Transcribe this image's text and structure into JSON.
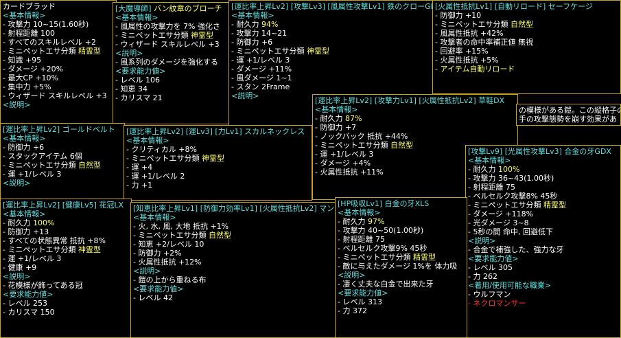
{
  "tooltips": [
    {
      "id": "t1",
      "title": [
        {
          "t": "カードブラッド",
          "c": "wt"
        }
      ],
      "sections": [
        {
          "header": "<基本情報>",
          "lines": [
            [
              {
                "t": "- 攻撃力 10~15(1.60秒)"
              }
            ],
            [
              {
                "t": "- 射程距離 100"
              }
            ],
            [
              {
                "t": "- すべてのスキルレベル +2"
              }
            ],
            [
              {
                "t": "- ミニペットエサ分類 "
              },
              {
                "t": "精霊型",
                "c": "sp"
              }
            ],
            [
              {
                "t": "- 知識 +95"
              }
            ],
            [
              {
                "t": "- ダメージ +20%"
              }
            ],
            [
              {
                "t": "- 最大CP +10%"
              }
            ],
            [
              {
                "t": "- 集中力 +5%"
              }
            ],
            [
              {
                "t": "- ウィザード スキルレベル +3"
              }
            ]
          ]
        },
        {
          "header": "<説明>",
          "lines": []
        }
      ]
    },
    {
      "id": "t2",
      "title": [
        {
          "t": "[大魔導師] ",
          "c": "cy"
        },
        {
          "t": "バン紋章のブローチ",
          "c": "nat"
        }
      ],
      "sections": [
        {
          "header": "<基本情報>",
          "lines": [
            [
              {
                "t": "- 風属性の攻撃力を 7% 強化さ"
              }
            ],
            [
              {
                "t": "- ミニペットエサ分類 "
              },
              {
                "t": "神霊型",
                "c": "sp"
              }
            ],
            [
              {
                "t": "- ウィザード スキルレベル +3"
              }
            ]
          ]
        },
        {
          "header": "<説明>",
          "lines": [
            [
              {
                "t": "- 風系列のダメージを強化する"
              }
            ]
          ]
        },
        {
          "header": "<要求能力値>",
          "lines": [
            [
              {
                "t": "- レベル 106"
              }
            ],
            [
              {
                "t": "- 知恵 34"
              }
            ],
            [
              {
                "t": "- カリスマ 21"
              }
            ]
          ]
        }
      ]
    },
    {
      "id": "t3",
      "title": [
        {
          "t": "[運比率上昇Lv2] [攻撃Lv3] [風属性攻撃Lv1] 鉄のクローGDX",
          "c": "cy"
        }
      ],
      "sections": [
        {
          "header": "<基本情報>",
          "lines": [
            [
              {
                "t": "- 耐久力 "
              },
              {
                "t": "94%",
                "c": "nat"
              }
            ],
            [
              {
                "t": "- 攻撃力 14~21"
              }
            ],
            [
              {
                "t": "- 防御力 +6"
              }
            ],
            [
              {
                "t": "- ミニペットエサ分類 "
              },
              {
                "t": "神霊型",
                "c": "sp"
              }
            ],
            [
              {
                "t": "- 運 +1/レベル 3"
              }
            ],
            [
              {
                "t": "- ダメージ +11%"
              }
            ],
            [
              {
                "t": "- 風ダメージ 1~1"
              }
            ],
            [
              {
                "t": "- スタン 2Frame"
              }
            ]
          ]
        },
        {
          "header": "<説明>",
          "lines": []
        }
      ]
    },
    {
      "id": "t4",
      "title": [
        {
          "t": "[火属性抵抗Lv1] [自動リロード] セーフケージ",
          "c": "cy"
        }
      ],
      "sections": [
        {
          "header": "",
          "lines": [
            [
              {
                "t": "- 防御力 +10"
              }
            ],
            [
              {
                "t": "- ミニペットエサ分類 "
              },
              {
                "t": "自然型",
                "c": "nat"
              }
            ],
            [
              {
                "t": "- 風属性抵抗 +42%"
              }
            ],
            [
              {
                "t": "- 攻撃者の命中率補正値 無視"
              }
            ],
            [
              {
                "t": "- 回避率 +15%"
              }
            ],
            [
              {
                "t": "- 火属性抵抗 +5%"
              }
            ],
            [
              {
                "t": "- アイテム自動リロード",
                "c": "nat"
              }
            ]
          ]
        }
      ]
    },
    {
      "id": "t5",
      "title": [
        {
          "t": "[運比率上昇Lv2] ゴールドベルト",
          "c": "cy"
        }
      ],
      "sections": [
        {
          "header": "<基本情報>",
          "lines": [
            [
              {
                "t": "- 防御力 +6"
              }
            ],
            [
              {
                "t": "- スタックアイテム 6個"
              }
            ],
            [
              {
                "t": "- ミニペットエサ分類 "
              },
              {
                "t": "自然型",
                "c": "nat"
              }
            ],
            [
              {
                "t": "- 運 +1/レベル 3"
              }
            ]
          ]
        },
        {
          "header": "<説明>",
          "lines": []
        }
      ]
    },
    {
      "id": "t6",
      "title": [
        {
          "t": "[運比率上昇Lv2] [運Lv3] [力Lv1] スカルネックレス",
          "c": "cy"
        }
      ],
      "sections": [
        {
          "header": "<基本情報>",
          "lines": [
            [
              {
                "t": "- クリティカル +8%"
              }
            ],
            [
              {
                "t": "- ミニペットエサ分類 "
              },
              {
                "t": "神霊型",
                "c": "sp"
              }
            ],
            [
              {
                "t": "- 運 +4"
              }
            ],
            [
              {
                "t": "- 運 +1/レベル 2"
              }
            ],
            [
              {
                "t": "- 力 +1"
              }
            ]
          ]
        }
      ]
    },
    {
      "id": "t7",
      "title": [
        {
          "t": "[運比率上昇Lv2] [攻撃力Lv1] [火属性抵抗Lv2] 草鞋DX",
          "c": "cy"
        }
      ],
      "sections": [
        {
          "header": "<基本情報>",
          "lines": [
            [
              {
                "t": "- 耐久力 "
              },
              {
                "t": "87%",
                "c": "nat"
              }
            ],
            [
              {
                "t": "- 防御力 +7"
              }
            ],
            [
              {
                "t": "- ノックバック 抵抗 +44%"
              }
            ],
            [
              {
                "t": "- ミニペットエサ分類 "
              },
              {
                "t": "自然型",
                "c": "nat"
              }
            ],
            [
              {
                "t": "- 運 +1/レベル 3"
              }
            ],
            [
              {
                "t": "- ダメージ +4%"
              }
            ],
            [
              {
                "t": "- 火属性抵抗 +11%"
              }
            ]
          ]
        }
      ]
    },
    {
      "id": "t8",
      "title": [
        {
          "t": "の模様がある鎧。この縦格子の",
          "c": "wt"
        }
      ],
      "sections": [
        {
          "header": "",
          "lines": [
            [
              {
                "t": "手の攻撃態勢を崩す効果があ"
              }
            ]
          ]
        }
      ]
    },
    {
      "id": "t9",
      "title": [
        {
          "t": "[攻撃Lv9] [光属性攻撃Lv3] 合金の牙GDX",
          "c": "cy"
        }
      ],
      "sections": [
        {
          "header": "<基本情報>",
          "lines": [
            [
              {
                "t": "- 耐久力 "
              },
              {
                "t": "100%",
                "c": "nat"
              }
            ],
            [
              {
                "t": "- 攻撃力 36~43(1.00秒)"
              }
            ],
            [
              {
                "t": "- 射程距離 75"
              }
            ],
            [
              {
                "t": "- ベルセルク攻撃8% 45秒"
              }
            ],
            [
              {
                "t": "- ミニペットエサ分類 "
              },
              {
                "t": "精霊型",
                "c": "sp"
              }
            ],
            [
              {
                "t": "- ダメージ +118%"
              }
            ],
            [
              {
                "t": "- 光ダメージ 3~8"
              }
            ],
            [
              {
                "t": "- 5秒の間 命中, 回避低下"
              }
            ]
          ]
        },
        {
          "header": "<説明>",
          "lines": [
            [
              {
                "t": "- 合金で補強した、強力な牙"
              }
            ]
          ]
        },
        {
          "header": "<要求能力値>",
          "lines": [
            [
              {
                "t": "- レベル 305"
              }
            ],
            [
              {
                "t": "- 力 262"
              }
            ]
          ]
        },
        {
          "header": "<着用/使用可能な職業>",
          "lines": [
            [
              {
                "t": "- ウルフマン"
              }
            ],
            [
              {
                "t": "- ネクロマンサー",
                "c": "red"
              }
            ]
          ]
        }
      ]
    },
    {
      "id": "t10",
      "title": [
        {
          "t": "[運比率上昇Lv2] [健康Lv5] 花冠LX",
          "c": "cy"
        }
      ],
      "sections": [
        {
          "header": "<基本情報>",
          "lines": [
            [
              {
                "t": "- 耐久力 "
              },
              {
                "t": "100%",
                "c": "nat"
              }
            ],
            [
              {
                "t": "- 防御力 +13"
              }
            ],
            [
              {
                "t": "- すべての状態異常 抵抗 +8%"
              }
            ],
            [
              {
                "t": "- ミニペットエサ分類 "
              },
              {
                "t": "神霊型",
                "c": "sp"
              }
            ],
            [
              {
                "t": "- 運 +1/レベル 3"
              }
            ],
            [
              {
                "t": "- 健康 +9"
              }
            ]
          ]
        },
        {
          "header": "<説明>",
          "lines": [
            [
              {
                "t": "- 花模様が飾ってある冠"
              }
            ]
          ]
        },
        {
          "header": "<要求能力値>",
          "lines": [
            [
              {
                "t": "- レベル 253"
              }
            ],
            [
              {
                "t": "- カリスマ 150"
              }
            ]
          ]
        }
      ]
    },
    {
      "id": "t11",
      "title": [
        {
          "t": "[知恵比率上昇Lv1] [防御力効率Lv1] [火属性抵抗Lv2] マント",
          "c": "cy"
        }
      ],
      "sections": [
        {
          "header": "<基本情報>",
          "lines": [
            [
              {
                "t": "- 火, 水, 風, 大地 抵抗 +1%"
              }
            ],
            [
              {
                "t": "- ミニペットエサ分類 "
              },
              {
                "t": "自然型",
                "c": "nat"
              }
            ],
            [
              {
                "t": "- 知恵 +2/レベル 10"
              }
            ],
            [
              {
                "t": "- 防御力 +2%"
              }
            ],
            [
              {
                "t": "- 火属性抵抗 +12%"
              }
            ]
          ]
        },
        {
          "header": "<説明>",
          "lines": [
            [
              {
                "t": "- 鎧の上から重ねる布"
              }
            ]
          ]
        },
        {
          "header": "<要求能力値>",
          "lines": [
            [
              {
                "t": "- レベル 42"
              }
            ]
          ]
        }
      ]
    },
    {
      "id": "t12",
      "title": [
        {
          "t": "[HP吸収Lv1] 白金の牙XLS",
          "c": "cy"
        }
      ],
      "sections": [
        {
          "header": "<基本情報>",
          "lines": [
            [
              {
                "t": "- 耐久力 "
              },
              {
                "t": "97%",
                "c": "nat"
              }
            ],
            [
              {
                "t": "- 攻撃力 40~50(1.00秒)"
              }
            ],
            [
              {
                "t": "- 射程距離 75"
              }
            ],
            [
              {
                "t": "- ベルセルク攻撃9% 45秒"
              }
            ],
            [
              {
                "t": "- ミニペットエサ分類 "
              },
              {
                "t": "精霊型",
                "c": "sp"
              }
            ],
            [
              {
                "t": "- 敵に与えたダメージ 1%を 体力吸"
              }
            ]
          ]
        },
        {
          "header": "<説明>",
          "lines": [
            [
              {
                "t": "- 凄く丈夫な白金で出来た牙"
              }
            ]
          ]
        },
        {
          "header": "<要求能力値>",
          "lines": [
            [
              {
                "t": "- レベル 313"
              }
            ],
            [
              {
                "t": "- 力 372"
              }
            ]
          ]
        }
      ]
    }
  ]
}
